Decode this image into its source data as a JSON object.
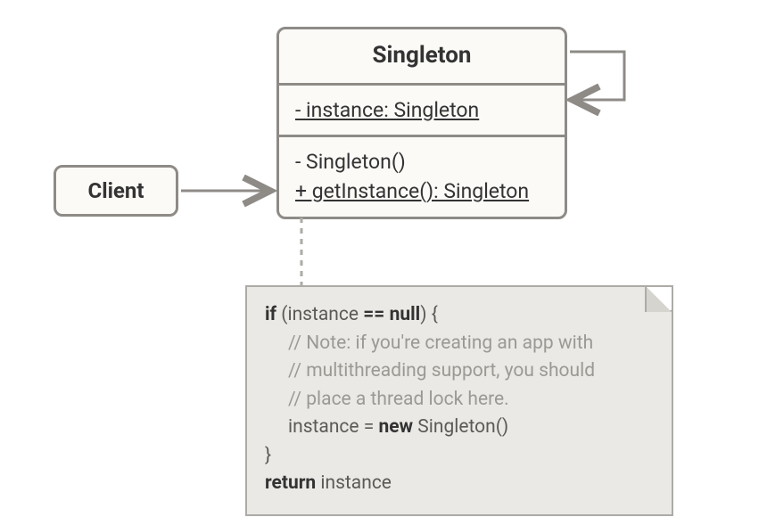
{
  "client": {
    "label": "Client"
  },
  "singleton": {
    "title": "Singleton",
    "attr1": "- instance: Singleton",
    "op1": "- Singleton()",
    "op2": "+ getInstance(): Singleton"
  },
  "note": {
    "line1_kw1": "if",
    "line1_rest1": " (instance ",
    "line1_kw2": "== null",
    "line1_rest2": ") {",
    "c1": "// Note: if you're creating an app with",
    "c2": "// multithreading support, you should",
    "c3": "// place a thread lock here.",
    "line5_a": "instance = ",
    "line5_kw": "new",
    "line5_b": " Singleton()",
    "line6": "}",
    "line7_kw": "return",
    "line7_rest": " instance"
  }
}
